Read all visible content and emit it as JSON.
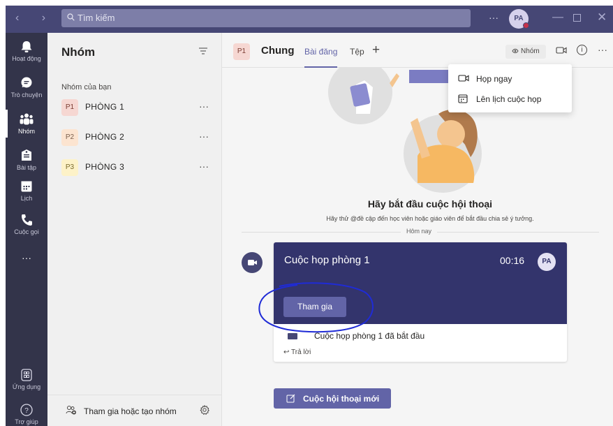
{
  "titlebar": {
    "search_placeholder": "Tìm kiếm",
    "more": "···",
    "avatar": "PA"
  },
  "rail": [
    {
      "label": "Hoạt động",
      "icon": "bell-icon"
    },
    {
      "label": "Trò chuyện",
      "icon": "chat-icon"
    },
    {
      "label": "Nhóm",
      "icon": "teams-icon",
      "active": true
    },
    {
      "label": "Bài tập",
      "icon": "assignments-icon"
    },
    {
      "label": "Lịch",
      "icon": "calendar-icon"
    },
    {
      "label": "Cuộc gọi",
      "icon": "phone-icon"
    },
    {
      "label": "···",
      "icon": "more-icon"
    }
  ],
  "rail_bottom": [
    {
      "label": "Ứng dụng",
      "icon": "apps-icon"
    },
    {
      "label": "Trợ giúp",
      "icon": "help-icon"
    }
  ],
  "panel": {
    "title": "Nhóm",
    "section_label": "Nhóm của bạn",
    "teams": [
      {
        "badge": "P1",
        "name": "PHÒNG 1",
        "color": "#f6d7d2"
      },
      {
        "badge": "P2",
        "name": "PHÒNG 2",
        "color": "#fce4d0"
      },
      {
        "badge": "P3",
        "name": "PHÒNG 3",
        "color": "#fdf2c8"
      }
    ],
    "team_more": "···",
    "join_label": "Tham gia hoặc tạo nhóm"
  },
  "channel": {
    "badge": "P1",
    "name": "Chung",
    "tabs": [
      "Bài đăng",
      "Tệp"
    ],
    "active_tab": "Bài đăng",
    "add_tab": "+",
    "team_button": "Nhóm",
    "info": "i",
    "more": "···"
  },
  "menu": {
    "items": [
      {
        "label": "Họp ngay",
        "icon": "video-camera-icon"
      },
      {
        "label": "Lên lịch cuộc họp",
        "icon": "calendar-icon"
      }
    ]
  },
  "empty_state": {
    "title": "Hãy bắt đầu cuộc hội thoại",
    "subtitle": "Hãy thử @đề cập đến học viên hoặc giáo viên để bắt đầu chia sẻ ý tưởng.",
    "day_divider": "Hôm nay"
  },
  "meeting_card": {
    "title": "Cuộc họp phòng 1",
    "elapsed": "00:16",
    "avatar": "PA",
    "join_button": "Tham gia",
    "started_text": "Cuộc họp phòng 1 đã bắt đầu",
    "reply": "Trả lời"
  },
  "new_conversation_button": "Cuộc hội thoại mới",
  "colors": {
    "brand": "#6264a7",
    "titlebar": "#464775",
    "rail": "#33344a",
    "card_header": "#33346c",
    "annotation": "#1f2bd6"
  }
}
